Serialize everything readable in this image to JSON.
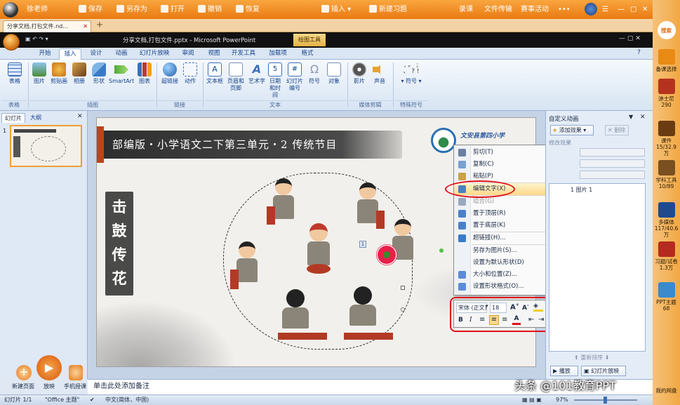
{
  "topbar": {
    "user": "徐老师",
    "save": "保存",
    "save_as": "另存为",
    "open": "打开",
    "undo": "撤销",
    "redo": "恢复",
    "insert": "插入",
    "new_question": "新建习题",
    "record": "录课",
    "file_transfer": "文件传输",
    "events": "赛事活动"
  },
  "doc_tab": "分享文档,打包文件.nd…",
  "ppt_title": "分享文档,打包文件.pptx - Microsoft PowerPoint",
  "drawing_tools": "绘图工具",
  "ribbon_tabs": [
    "开始",
    "插入",
    "设计",
    "动画",
    "幻灯片放映",
    "审阅",
    "视图",
    "开发工具",
    "加载项",
    "格式"
  ],
  "ribbon_active": "插入",
  "ribbon_buttons": {
    "table": "表格",
    "picture": "图片",
    "clipart": "剪贴画",
    "album": "相册",
    "shapes": "形状",
    "smartart": "SmartArt",
    "chart": "图表",
    "hyperlink": "超链接",
    "action": "动作",
    "textbox": "文本框",
    "header_footer": "页眉和页脚",
    "wordart": "艺术字",
    "datetime": "日期和时间",
    "slide_number": "幻灯片编号",
    "symbol": "符号",
    "object": "对象",
    "movie": "影片",
    "sound": "声音",
    "special_symbol": "符号"
  },
  "ribbon_groups": {
    "tables": "表格",
    "illustrations": "插图",
    "links": "链接",
    "text": "文本",
    "media": "媒体剪辑",
    "special": "特殊符号"
  },
  "left_tabs": {
    "slides": "幻灯片",
    "outline": "大纲"
  },
  "slide_thumb_number": "1",
  "slide": {
    "banner": "部编版・小学语文二下第三单元・2 传统节目",
    "school": "文安县第四小学",
    "vertical_title": [
      "击",
      "鼓",
      "传",
      "花"
    ],
    "anim_marker": "1"
  },
  "context_menu": [
    {
      "label": "剪切(T)",
      "state": "normal",
      "icon": "scissors-icon"
    },
    {
      "label": "复制(C)",
      "state": "normal",
      "icon": "copy-icon"
    },
    {
      "label": "粘贴(P)",
      "state": "normal",
      "icon": "paste-icon"
    },
    {
      "label": "编辑文字(X)",
      "state": "highlight",
      "icon": "edit-text-icon"
    },
    {
      "label": "组合(G)",
      "state": "disabled",
      "icon": "group-icon",
      "submenu": true
    },
    {
      "label": "置于顶层(R)",
      "state": "normal",
      "icon": "bring-front-icon",
      "submenu": true
    },
    {
      "label": "置于底层(K)",
      "state": "normal",
      "icon": "send-back-icon",
      "submenu": true
    },
    {
      "label": "超链接(H)...",
      "state": "normal",
      "icon": "hyperlink-icon"
    },
    {
      "label": "另存为图片(S)...",
      "state": "normal",
      "icon": ""
    },
    {
      "label": "设置为默认形状(D)",
      "state": "normal",
      "icon": ""
    },
    {
      "label": "大小和位置(Z)...",
      "state": "normal",
      "icon": "size-icon"
    },
    {
      "label": "设置形状格式(O)...",
      "state": "normal",
      "icon": "format-shape-icon"
    }
  ],
  "mini_toolbar": {
    "font": "宋体 (正文)",
    "size": "18",
    "bold": "B",
    "italic": "I"
  },
  "right_pane": {
    "title": "自定义动画",
    "add_effect": "添加效果",
    "remove": "删除",
    "modify_label": "修改效果",
    "list_item_number": "1",
    "list_item": "图片 1",
    "reorder": "重新排序",
    "play": "播放",
    "slideshow": "幻灯片放映"
  },
  "bottom_tools": {
    "new_page": "新建页面",
    "play": "放映",
    "phone_control": "手机授课"
  },
  "notes_placeholder": "单击此处添加备注",
  "watermark": "头条 @101教育PPT",
  "statusbar": {
    "slide_pos": "幻灯片 1/1",
    "theme": "\"Office 主题\"",
    "language": "中文(简体，中国)",
    "zoom": "97%"
  },
  "sidebar": [
    {
      "label": "搜索",
      "count": ""
    },
    {
      "label": "备课选择",
      "count": ""
    },
    {
      "label": "迪士尼",
      "count": "290"
    },
    {
      "label": "课件",
      "count": "15/32.9万"
    },
    {
      "label": "学科工具",
      "count": "10/89"
    },
    {
      "label": "多媒体",
      "count": "117/40.6万"
    },
    {
      "label": "习题/试卷",
      "count": "1.3万"
    },
    {
      "label": "PPT主题",
      "count": "68"
    },
    {
      "label": "我的网盘",
      "count": ""
    }
  ],
  "colors": {
    "topbar": "#ef8a20",
    "ribbon": "#dbe6f4",
    "highlight": "#ffd98a",
    "annotation_red": "#e0101a",
    "banner_dark": "#3a3a3a",
    "title_block": "#4a4a48"
  }
}
